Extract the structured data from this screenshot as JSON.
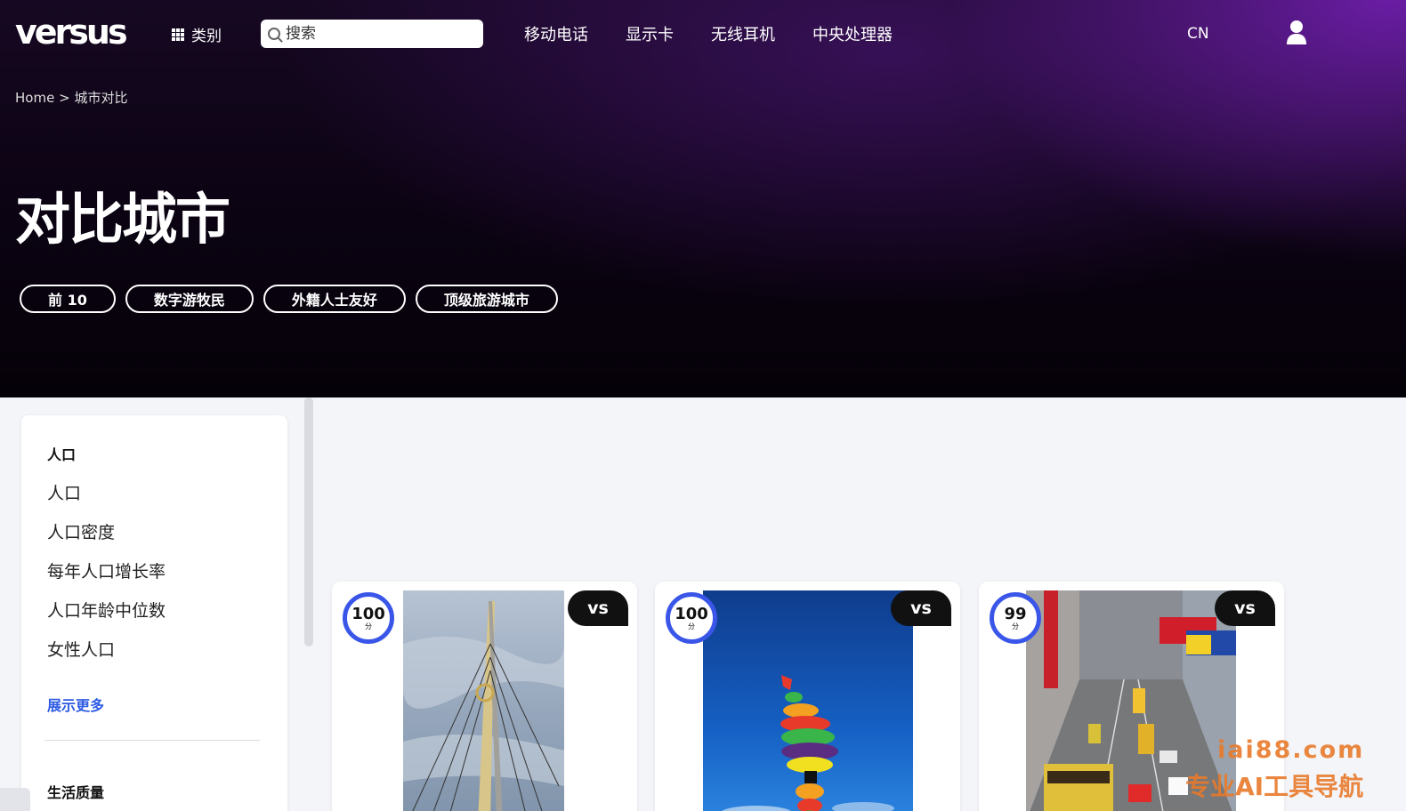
{
  "header": {
    "logo": "versus",
    "categories_label": "类别",
    "search_placeholder": "搜索",
    "nav": [
      "移动电话",
      "显示卡",
      "无线耳机",
      "中央处理器"
    ],
    "lang": "CN"
  },
  "breadcrumb": {
    "home": "Home",
    "sep": ">",
    "current": "城市对比"
  },
  "page_title": "对比城市",
  "chips": [
    "前 10",
    "数字游牧民",
    "外籍人士友好",
    "顶级旅游城市"
  ],
  "sidebar": {
    "section1_title": "人口",
    "items": [
      "人口",
      "人口密度",
      "每年人口增长率",
      "人口年龄中位数",
      "女性人口"
    ],
    "show_more": "展示更多",
    "section2_title": "生活质量"
  },
  "cards": [
    {
      "score": "100",
      "unit": "分",
      "vs": "vs",
      "photo": "bridge-photo"
    },
    {
      "score": "100",
      "unit": "分",
      "vs": "vs",
      "photo": "sculpture-photo"
    },
    {
      "score": "99",
      "unit": "分",
      "vs": "vs",
      "photo": "street-photo"
    }
  ],
  "watermark": {
    "line1": "iai88.com",
    "line2": "专业AI工具导航"
  },
  "colors": {
    "accent_blue": "#3a56e8",
    "hero_purple": "#6e1eaa",
    "watermark_orange": "#e87a2b"
  }
}
